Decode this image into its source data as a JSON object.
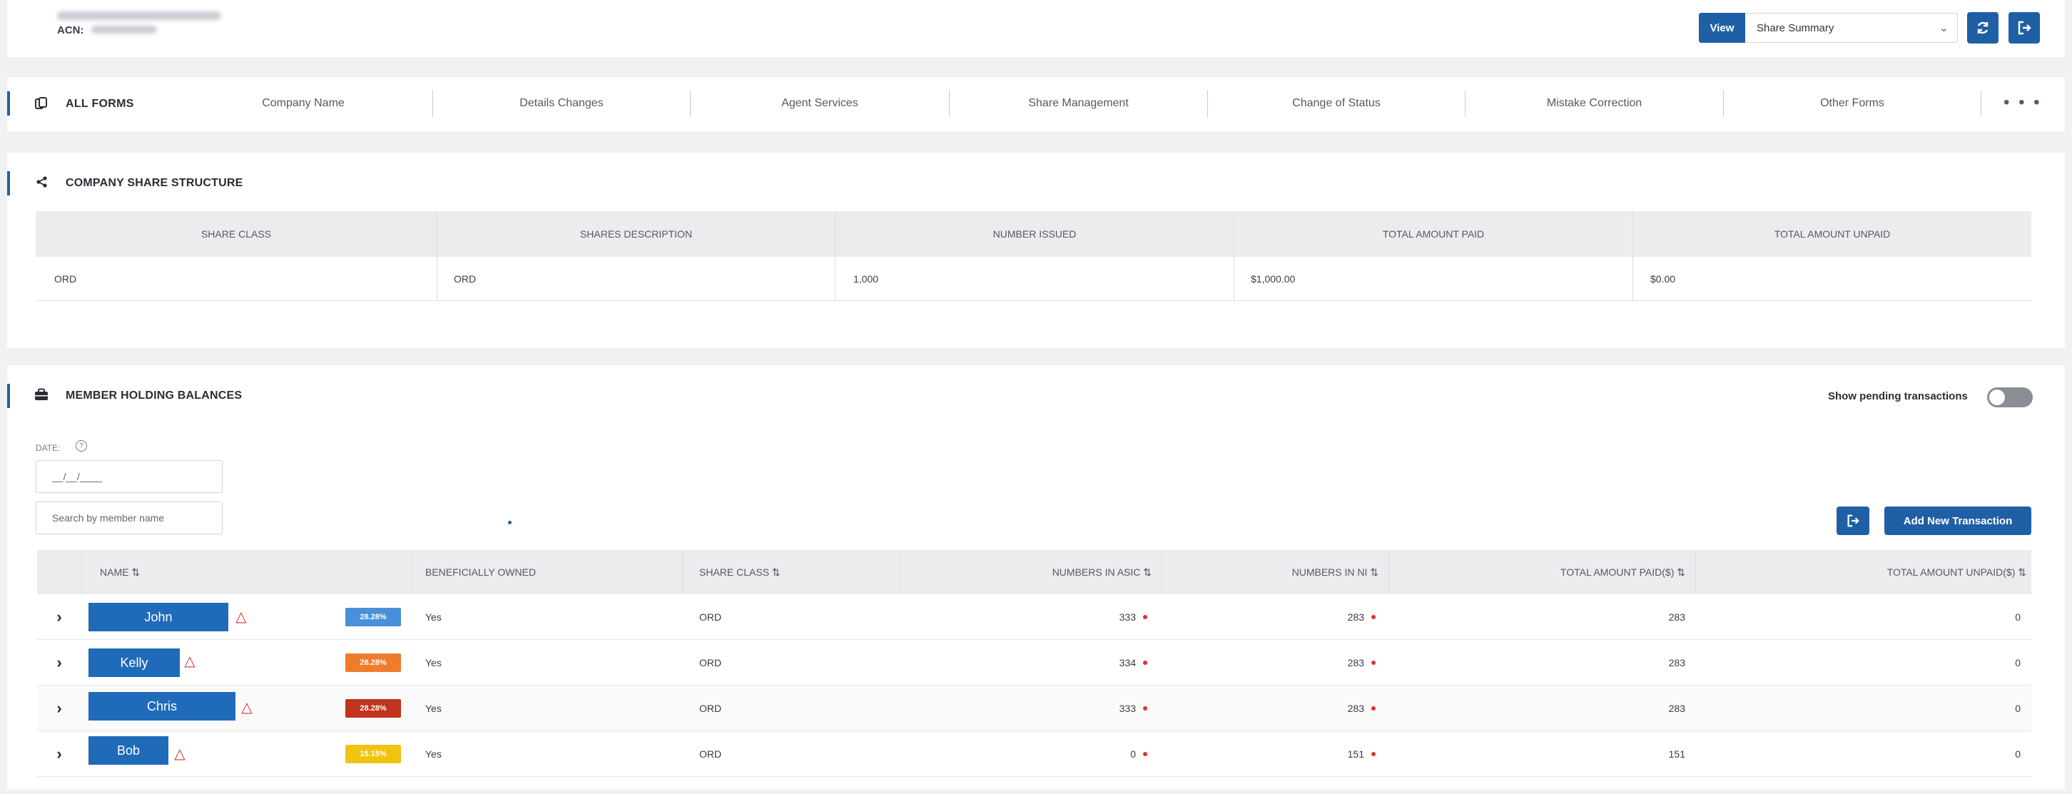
{
  "header": {
    "acn_label": "ACN:",
    "view_label": "View",
    "view_selected": "Share Summary"
  },
  "forms_nav": {
    "title": "ALL FORMS",
    "items": [
      "Company Name",
      "Details Changes",
      "Agent Services",
      "Share Management",
      "Change of Status",
      "Mistake Correction",
      "Other Forms"
    ],
    "more": "• • •"
  },
  "share_structure": {
    "title": "COMPANY SHARE STRUCTURE",
    "columns": [
      "SHARE CLASS",
      "SHARES DESCRIPTION",
      "NUMBER ISSUED",
      "TOTAL AMOUNT PAID",
      "TOTAL AMOUNT UNPAID"
    ],
    "rows": [
      [
        "ORD",
        "ORD",
        "1,000",
        "$1,000.00",
        "$0.00"
      ]
    ]
  },
  "member_holdings": {
    "title": "MEMBER HOLDING BALANCES",
    "toggle_label": "Show pending transactions",
    "date_label": "DATE:",
    "date_placeholder": "__/__/____",
    "search_placeholder": "Search by member name",
    "add_button": "Add New Transaction",
    "columns": [
      "NAME ⇅",
      "BENEFICIALLY OWNED",
      "SHARE CLASS ⇅",
      "NUMBERS IN ASIC ⇅",
      "NUMBERS IN NI ⇅",
      "TOTAL AMOUNT PAID($) ⇅",
      "TOTAL AMOUNT UNPAID($) ⇅"
    ],
    "rows": [
      {
        "name": "John",
        "pct": "28.28%",
        "pct_color": "#4a90d9",
        "beneficial": "Yes",
        "class": "ORD",
        "asic": "333",
        "ni": "283",
        "paid": "283",
        "unpaid": "0"
      },
      {
        "name": "Kelly",
        "pct": "28.28%",
        "pct_color": "#ee7d2b",
        "beneficial": "Yes",
        "class": "ORD",
        "asic": "334",
        "ni": "283",
        "paid": "283",
        "unpaid": "0"
      },
      {
        "name": "Chris",
        "pct": "28.28%",
        "pct_color": "#c0331c",
        "beneficial": "Yes",
        "class": "ORD",
        "asic": "333",
        "ni": "283",
        "paid": "283",
        "unpaid": "0"
      },
      {
        "name": "Bob",
        "pct": "15.15%",
        "pct_color": "#f0c30f",
        "beneficial": "Yes",
        "class": "ORD",
        "asic": "0",
        "ni": "151",
        "paid": "151",
        "unpaid": "0"
      }
    ]
  },
  "icons": {
    "refresh": "refresh-icon",
    "export": "export-icon",
    "forms": "forms-icon",
    "share": "share-icon",
    "briefcase": "briefcase-icon",
    "warning": "warning-icon",
    "chevron_right": "chevron-right-icon",
    "info": "info-icon"
  }
}
